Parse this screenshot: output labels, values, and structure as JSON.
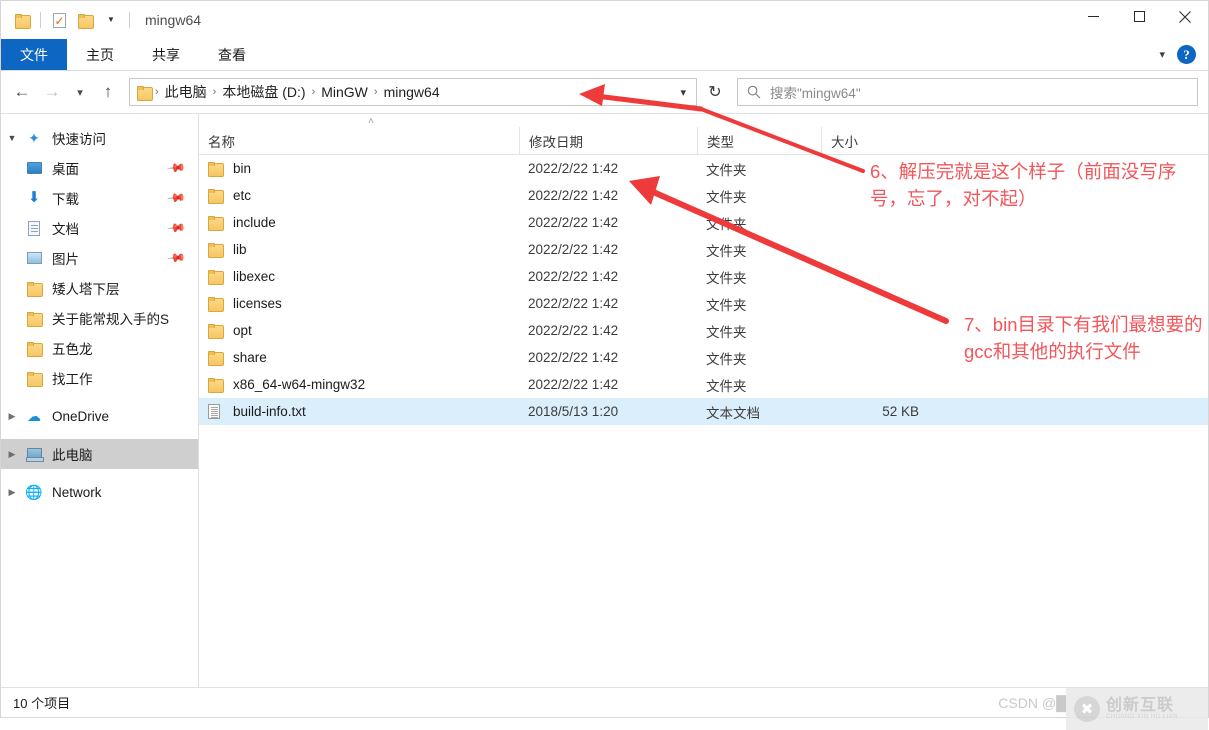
{
  "window": {
    "title": "mingw64",
    "quick_access": [
      "folder-icon",
      "properties-icon",
      "new-folder-icon",
      "customize-caret-icon"
    ],
    "controls": {
      "minimize": "—",
      "maximize": "□",
      "close": "✕"
    }
  },
  "ribbon": {
    "tabs": [
      {
        "label": "文件",
        "active": true
      },
      {
        "label": "主页",
        "active": false
      },
      {
        "label": "共享",
        "active": false
      },
      {
        "label": "查看",
        "active": false
      }
    ],
    "expand_caret": "∨",
    "help_label": "?"
  },
  "navbar": {
    "back": "←",
    "forward": "→",
    "recent_caret": "∨",
    "up": "↑",
    "breadcrumbs": [
      "此电脑",
      "本地磁盘 (D:)",
      "MinGW",
      "mingw64"
    ],
    "breadcrumb_separator": "›",
    "dropdown_caret": "∨",
    "refresh": "↻",
    "search_placeholder": "搜索\"mingw64\""
  },
  "sidebar": {
    "items": [
      {
        "label": "快速访问",
        "icon": "star-icon",
        "chevron": "open",
        "indent": 0,
        "pinned": false,
        "selected": false
      },
      {
        "label": "桌面",
        "icon": "desktop-icon",
        "chevron": "none",
        "indent": 1,
        "pinned": true,
        "selected": false
      },
      {
        "label": "下载",
        "icon": "download-icon",
        "chevron": "none",
        "indent": 1,
        "pinned": true,
        "selected": false
      },
      {
        "label": "文档",
        "icon": "documents-icon",
        "chevron": "none",
        "indent": 1,
        "pinned": true,
        "selected": false
      },
      {
        "label": "图片",
        "icon": "pictures-icon",
        "chevron": "none",
        "indent": 1,
        "pinned": true,
        "selected": false
      },
      {
        "label": "矮人塔下层",
        "icon": "folder-icon",
        "chevron": "none",
        "indent": 1,
        "pinned": false,
        "selected": false
      },
      {
        "label": "关于能常规入手的S",
        "icon": "folder-icon",
        "chevron": "none",
        "indent": 1,
        "pinned": false,
        "selected": false
      },
      {
        "label": "五色龙",
        "icon": "folder-icon",
        "chevron": "none",
        "indent": 1,
        "pinned": false,
        "selected": false
      },
      {
        "label": "找工作",
        "icon": "folder-icon",
        "chevron": "none",
        "indent": 1,
        "pinned": false,
        "selected": false
      },
      {
        "label": "OneDrive",
        "icon": "onedrive-icon",
        "chevron": "closed",
        "indent": 0,
        "pinned": false,
        "selected": false
      },
      {
        "label": "此电脑",
        "icon": "this-pc-icon",
        "chevron": "closed",
        "indent": 0,
        "pinned": false,
        "selected": true
      },
      {
        "label": "Network",
        "icon": "network-icon",
        "chevron": "closed",
        "indent": 0,
        "pinned": false,
        "selected": false
      }
    ]
  },
  "filelist": {
    "sort_indicator": "˄",
    "columns": [
      {
        "key": "name",
        "label": "名称"
      },
      {
        "key": "date",
        "label": "修改日期"
      },
      {
        "key": "type",
        "label": "类型"
      },
      {
        "key": "size",
        "label": "大小"
      }
    ],
    "rows": [
      {
        "name": "bin",
        "date": "2022/2/22 1:42",
        "type": "文件夹",
        "size": "",
        "icon": "folder-icon",
        "selected": false
      },
      {
        "name": "etc",
        "date": "2022/2/22 1:42",
        "type": "文件夹",
        "size": "",
        "icon": "folder-icon",
        "selected": false
      },
      {
        "name": "include",
        "date": "2022/2/22 1:42",
        "type": "文件夹",
        "size": "",
        "icon": "folder-icon",
        "selected": false
      },
      {
        "name": "lib",
        "date": "2022/2/22 1:42",
        "type": "文件夹",
        "size": "",
        "icon": "folder-icon",
        "selected": false
      },
      {
        "name": "libexec",
        "date": "2022/2/22 1:42",
        "type": "文件夹",
        "size": "",
        "icon": "folder-icon",
        "selected": false
      },
      {
        "name": "licenses",
        "date": "2022/2/22 1:42",
        "type": "文件夹",
        "size": "",
        "icon": "folder-icon",
        "selected": false
      },
      {
        "name": "opt",
        "date": "2022/2/22 1:42",
        "type": "文件夹",
        "size": "",
        "icon": "folder-icon",
        "selected": false
      },
      {
        "name": "share",
        "date": "2022/2/22 1:42",
        "type": "文件夹",
        "size": "",
        "icon": "folder-icon",
        "selected": false
      },
      {
        "name": "x86_64-w64-mingw32",
        "date": "2022/2/22 1:42",
        "type": "文件夹",
        "size": "",
        "icon": "folder-icon",
        "selected": false
      },
      {
        "name": "build-info.txt",
        "date": "2018/5/13 1:20",
        "type": "文本文档",
        "size": "52 KB",
        "icon": "text-file-icon",
        "selected": true
      }
    ]
  },
  "annotations": {
    "color": "#f2555a",
    "note1": "6、解压完就是这个样子（前面没写序号，忘了，对不起）",
    "note2": "7、bin目录下有我们最想要的gcc和其他的执行文件"
  },
  "statusbar": {
    "item_count": "10 个项目",
    "csdn_credit": "CSDN @█",
    "watermark_main": "创新互联",
    "watermark_sub": "CHUANG XIN HU LIAN"
  }
}
